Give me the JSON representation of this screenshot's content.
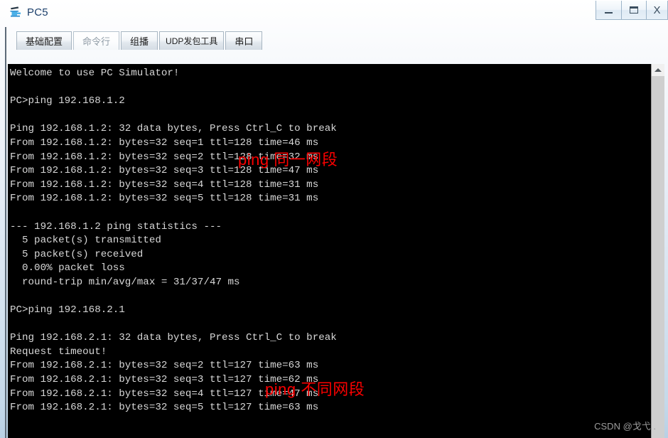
{
  "window": {
    "title": "PC5",
    "icon": "pc-device-icon",
    "controls": {
      "minimize": "–",
      "maximize": "□",
      "close": "X"
    }
  },
  "tabs": [
    {
      "label": "基础配置",
      "active": false
    },
    {
      "label": "命令行",
      "active": true
    },
    {
      "label": "组播",
      "active": false
    },
    {
      "label": "UDP发包工具",
      "active": false
    },
    {
      "label": "串口",
      "active": false
    }
  ],
  "terminal": {
    "lines": [
      "Welcome to use PC Simulator!",
      "",
      "PC>ping 192.168.1.2",
      "",
      "Ping 192.168.1.2: 32 data bytes, Press Ctrl_C to break",
      "From 192.168.1.2: bytes=32 seq=1 ttl=128 time=46 ms",
      "From 192.168.1.2: bytes=32 seq=2 ttl=128 time=32 ms",
      "From 192.168.1.2: bytes=32 seq=3 ttl=128 time=47 ms",
      "From 192.168.1.2: bytes=32 seq=4 ttl=128 time=31 ms",
      "From 192.168.1.2: bytes=32 seq=5 ttl=128 time=31 ms",
      "",
      "--- 192.168.1.2 ping statistics ---",
      "  5 packet(s) transmitted",
      "  5 packet(s) received",
      "  0.00% packet loss",
      "  round-trip min/avg/max = 31/37/47 ms",
      "",
      "PC>ping 192.168.2.1",
      "",
      "Ping 192.168.2.1: 32 data bytes, Press Ctrl_C to break",
      "Request timeout!",
      "From 192.168.2.1: bytes=32 seq=2 ttl=127 time=63 ms",
      "From 192.168.2.1: bytes=32 seq=3 ttl=127 time=62 ms",
      "From 192.168.2.1: bytes=32 seq=4 ttl=127 time=47 ms",
      "From 192.168.2.1: bytes=32 seq=5 ttl=127 time=63 ms"
    ]
  },
  "annotations": {
    "same_subnet": "ping 同一网段",
    "different_subnet": "ping 不同网段",
    "color": "#fb0000"
  },
  "scrollbar": {
    "up_arrow": "scroll-up-arrow"
  },
  "watermark": {
    "text": "CSDN @戈弋 ."
  }
}
